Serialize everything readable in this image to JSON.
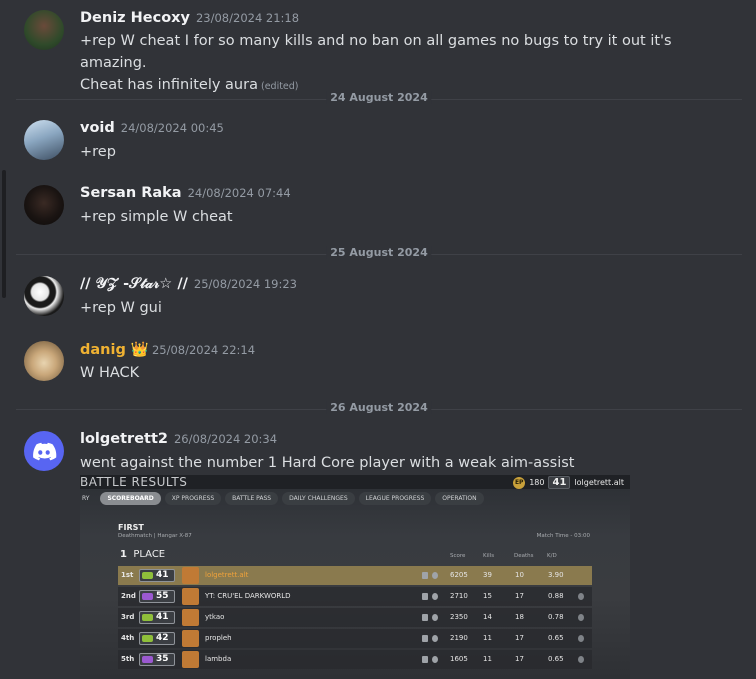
{
  "messages": [
    {
      "author": "Deniz Hecoxy",
      "timestamp": "23/08/2024 21:18",
      "lines": [
        "+rep W cheat I for so many kills and no ban on all games no bugs to try it out it's amazing.",
        "Cheat has infinitely aura"
      ],
      "edited": "(edited)"
    },
    {
      "author": "void",
      "timestamp": "24/08/2024 00:45",
      "text": "+rep"
    },
    {
      "author": "Sersan Raka",
      "timestamp": "24/08/2024 07:44",
      "text": "+rep simple W cheat"
    },
    {
      "author": "// 𝒴𝒵 -𝒮𝓉𝒶𝓇☆ //",
      "timestamp": "25/08/2024 19:23",
      "text": "+rep W gui"
    },
    {
      "author": "danig",
      "crown": "👑",
      "timestamp": "25/08/2024 22:14",
      "text": "W HACK",
      "author_color": "#f0b232"
    },
    {
      "author": "lolgetrett2",
      "timestamp": "26/08/2024 20:34",
      "text": "went against the number 1 Hard Core player with a weak aim-assist"
    }
  ],
  "dividers": [
    "24 August 2024",
    "25 August 2024",
    "26 August 2024"
  ],
  "embed": {
    "title": "BATTLE RESULTS",
    "currency_icon": "EP",
    "currency": "180",
    "level": "41",
    "username": "lolgetrett.alt",
    "tabs": [
      "RY",
      "SCOREBOARD",
      "XP PROGRESS",
      "BATTLE PASS",
      "DAILY CHALLENGES",
      "LEAGUE PROGRESS",
      "OPERATION"
    ],
    "active_tab": "SCOREBOARD",
    "result": "FIRST",
    "mode": "Deathmatch | Hangar X-87",
    "match_time": "Match Time - 03:00",
    "place_num": "1",
    "place_label": "PLACE",
    "columns": [
      "Score",
      "Kills",
      "Deaths",
      "K/D"
    ],
    "rows": [
      {
        "rank": "1st",
        "level": "41",
        "name": "lolgetrett.alt",
        "score": "6205",
        "kills": "39",
        "deaths": "10",
        "kd": "3.90",
        "badge_color": "#8fbf3a",
        "highlight": true
      },
      {
        "rank": "2nd",
        "level": "55",
        "name": "YT: CRU'EL DARKWORLD",
        "score": "2710",
        "kills": "15",
        "deaths": "17",
        "kd": "0.88",
        "badge_color": "#9b59d0"
      },
      {
        "rank": "3rd",
        "level": "41",
        "name": "ytkao",
        "score": "2350",
        "kills": "14",
        "deaths": "18",
        "kd": "0.78",
        "badge_color": "#8fbf3a"
      },
      {
        "rank": "4th",
        "level": "42",
        "name": "propleh",
        "score": "2190",
        "kills": "11",
        "deaths": "17",
        "kd": "0.65",
        "badge_color": "#8fbf3a"
      },
      {
        "rank": "5th",
        "level": "35",
        "name": "lambda",
        "score": "1605",
        "kills": "11",
        "deaths": "17",
        "kd": "0.65",
        "badge_color": "#9b59d0"
      }
    ]
  }
}
